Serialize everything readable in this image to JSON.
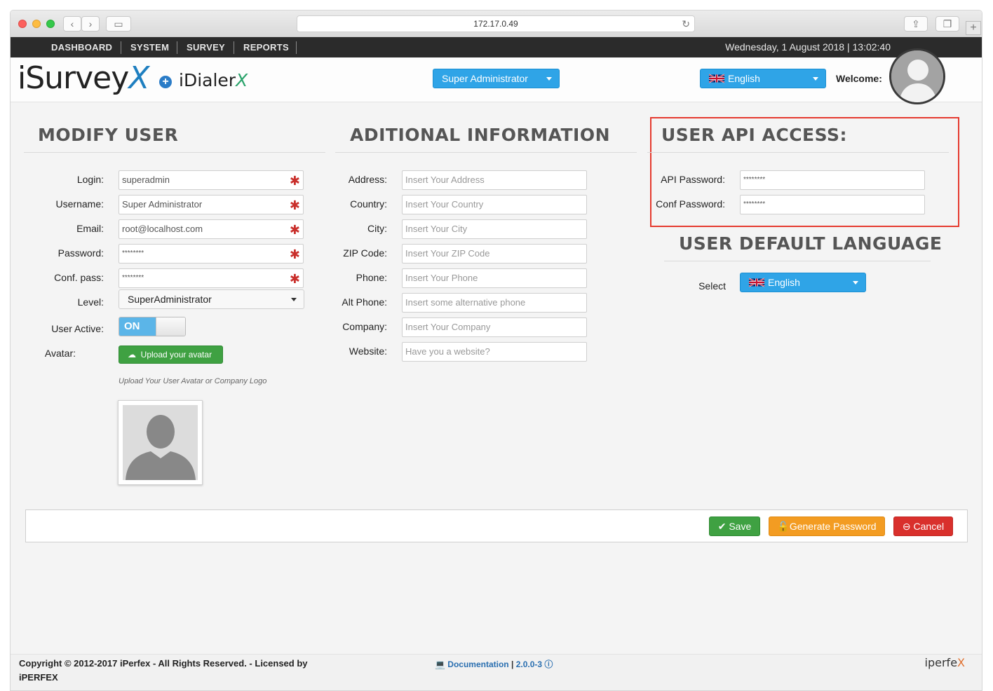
{
  "browser": {
    "url": "172.17.0.49"
  },
  "topnav": {
    "items": [
      "DASHBOARD",
      "SYSTEM",
      "SURVEY",
      "REPORTS"
    ],
    "datetime": "Wednesday, 1 August 2018 | 13:02:40"
  },
  "header": {
    "logo_main": "iSurvey",
    "logo_main_x": "X",
    "logo_second": "iDialer",
    "logo_second_x": "X",
    "role_select": "Super Administrator",
    "language_select": "English",
    "welcome": "Welcome:"
  },
  "modify_user": {
    "title": "MODIFY USER",
    "fields": [
      {
        "label": "Login:",
        "value": "superadmin"
      },
      {
        "label": "Username:",
        "value": "Super Administrator"
      },
      {
        "label": "Email:",
        "value": "root@localhost.com"
      },
      {
        "label": "Password:",
        "value": "********"
      },
      {
        "label": "Conf. pass:",
        "value": "********"
      }
    ],
    "level_label": "Level:",
    "level_value": "SuperAdministrator",
    "active_label": "User Active:",
    "active_value": "ON",
    "avatar_label": "Avatar:",
    "upload_button": "Upload your avatar",
    "upload_hint": "Upload Your User Avatar or Company Logo"
  },
  "additional_info": {
    "title": "ADITIONAL INFORMATION",
    "fields": [
      {
        "label": "Address:",
        "placeholder": "Insert Your Address"
      },
      {
        "label": "Country:",
        "placeholder": "Insert Your Country"
      },
      {
        "label": "City:",
        "placeholder": "Insert Your City"
      },
      {
        "label": "ZIP Code:",
        "placeholder": "Insert Your ZIP Code"
      },
      {
        "label": "Phone:",
        "placeholder": "Insert Your Phone"
      },
      {
        "label": "Alt Phone:",
        "placeholder": "Insert some alternative phone"
      },
      {
        "label": "Company:",
        "placeholder": "Insert Your Company"
      },
      {
        "label": "Website:",
        "placeholder": "Have you a website?"
      }
    ]
  },
  "api_access": {
    "title": "USER API ACCESS:",
    "fields": [
      {
        "label": "API Password:",
        "value": "********"
      },
      {
        "label": "Conf Password:",
        "value": "********"
      }
    ]
  },
  "default_language": {
    "title": "USER DEFAULT LANGUAGE",
    "select_label": "Select",
    "value": "English"
  },
  "actions": {
    "save": "Save",
    "generate": "Generate Password",
    "cancel": "Cancel"
  },
  "footer": {
    "copyright": "Copyright © 2012-2017 iPerfex - All Rights Reserved. - Licensed by iPERFEX",
    "documentation": "Documentation",
    "version": "2.0.0-3",
    "brand": "iperfe",
    "brand_x": "X"
  },
  "colors": {
    "primary": "#2fa4e7",
    "success": "#3fa142",
    "warning": "#f39c22",
    "danger": "#d9302c",
    "highlight": "#e53a2f"
  }
}
